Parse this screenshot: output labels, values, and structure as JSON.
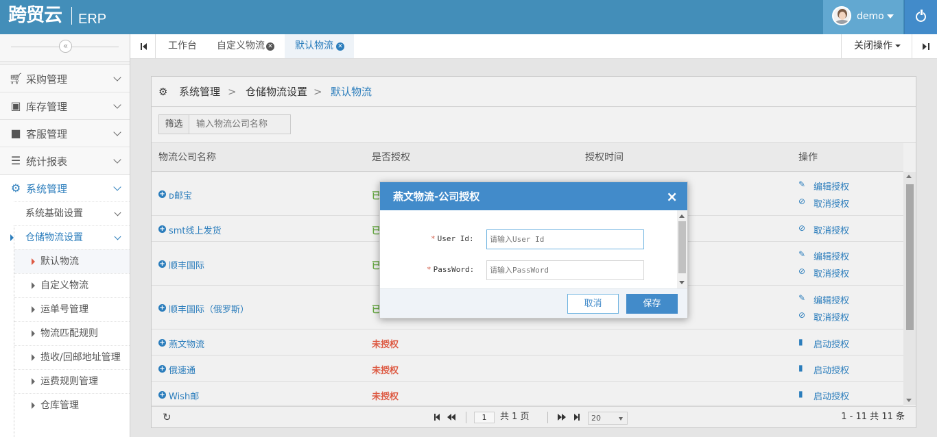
{
  "header": {
    "logo_text": "跨贸云",
    "app_name": "ERP",
    "username": "demo",
    "brand_color": "#438eb9"
  },
  "sidebar": {
    "collapse_icon": "«",
    "menus": [
      {
        "label": "采购管理",
        "icon": "cart-icon"
      },
      {
        "label": "库存管理",
        "icon": "inbox-icon"
      },
      {
        "label": "客服管理",
        "icon": "briefcase-icon"
      },
      {
        "label": "统计报表",
        "icon": "list-icon"
      },
      {
        "label": "系统管理",
        "icon": "gear-icon"
      }
    ],
    "sub_menus": [
      {
        "label": "系统基础设置"
      },
      {
        "label": "仓储物流设置"
      }
    ],
    "leaves": [
      {
        "label": "默认物流"
      },
      {
        "label": "自定义物流"
      },
      {
        "label": "运单号管理"
      },
      {
        "label": "物流匹配规则"
      },
      {
        "label": "揽收/回邮地址管理"
      },
      {
        "label": "运费规则管理"
      },
      {
        "label": "仓库管理"
      }
    ]
  },
  "tabs": {
    "items": [
      {
        "label": "工作台"
      },
      {
        "label": "自定义物流"
      },
      {
        "label": "默认物流"
      }
    ],
    "close_ops": "关闭操作"
  },
  "breadcrumb": {
    "items": [
      "系统管理",
      "仓储物流设置",
      "默认物流"
    ],
    "separator": ">"
  },
  "filter": {
    "label": "筛选",
    "placeholder": "输入物流公司名称"
  },
  "table": {
    "columns": [
      "物流公司名称",
      "是否授权",
      "授权时间",
      "操作"
    ],
    "rows": [
      {
        "name": "ᴅ邮宝",
        "auth": "已",
        "ops": [
          "编辑授权",
          "取消授权"
        ]
      },
      {
        "name": "smt线上发货",
        "auth": "已",
        "ops": [
          "取消授权"
        ]
      },
      {
        "name": "顺丰国际",
        "auth": "已",
        "ops": [
          "编辑授权",
          "取消授权"
        ]
      },
      {
        "name": "顺丰国际（俄罗斯）",
        "auth": "已",
        "ops": [
          "编辑授权",
          "取消授权"
        ]
      },
      {
        "name": "燕文物流",
        "auth": "未授权",
        "ops": [
          "启动授权"
        ]
      },
      {
        "name": "俄速通",
        "auth": "未授权",
        "ops": [
          "启动授权"
        ]
      },
      {
        "name": "Wish邮",
        "auth": "未授权",
        "ops": [
          "启动授权"
        ]
      }
    ]
  },
  "pager": {
    "page": "1",
    "total_pages_text": "共 1 页",
    "page_size": "20",
    "count_text": "1 - 11  共 11 条"
  },
  "modal": {
    "title": "燕文物流-公司授权",
    "close": "×",
    "fields": [
      {
        "label": "User Id:",
        "placeholder": "请输入User Id"
      },
      {
        "label": "PassWord:",
        "placeholder": "请输入PassWord"
      }
    ],
    "cancel_label": "取消",
    "save_label": "保存",
    "required_mark": "*"
  }
}
